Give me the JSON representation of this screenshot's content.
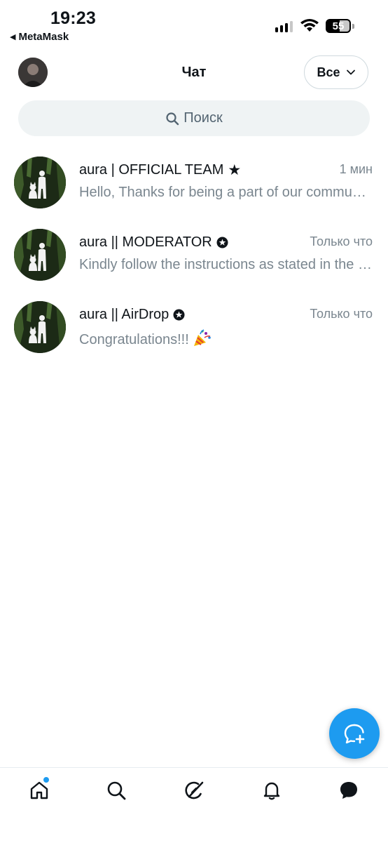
{
  "status_bar": {
    "time": "19:23",
    "back_app": "MetaMask",
    "battery": "55"
  },
  "header": {
    "title": "Чат",
    "filter_label": "Все"
  },
  "search": {
    "placeholder": "Поиск"
  },
  "conversations": [
    {
      "name": "aura | OFFICIAL TEAM",
      "badge": "star-icon",
      "time": "1 мин",
      "message": "Hello, Thanks for being a part of our community"
    },
    {
      "name": "aura || MODERATOR",
      "badge": "verified-star-badge-icon",
      "time": "Только что",
      "message": "Kindly follow the instructions as stated in the message"
    },
    {
      "name": "aura || AirDrop",
      "badge": "verified-star-badge-icon",
      "time": "Только что",
      "message": "Congratulations!!!",
      "emoji": "party-popper-icon"
    }
  ],
  "fab": {
    "icon": "new-message-icon",
    "color": "#1d9bf0"
  },
  "bottom_nav": {
    "items": [
      "home-icon",
      "search-icon",
      "grok-icon",
      "notifications-icon",
      "messages-icon"
    ],
    "active": "messages-icon",
    "notification_dot_color": "#1d9bf0"
  }
}
